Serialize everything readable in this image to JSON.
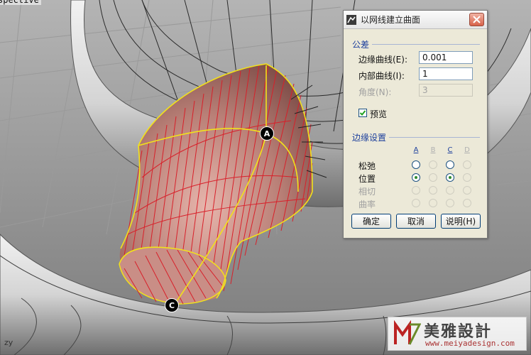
{
  "viewport": {
    "label": "spective",
    "markers": [
      {
        "letter": "A"
      },
      {
        "letter": "C"
      }
    ],
    "axis_label": "zy"
  },
  "dialog": {
    "title": "以网线建立曲面",
    "tolerance": {
      "header": "公差",
      "edge_curves": {
        "label": "边缘曲线(E):",
        "value": "0.001"
      },
      "inner_curves": {
        "label": "内部曲线(I):",
        "value": "1"
      },
      "angle": {
        "label": "角度(N):",
        "value": "3"
      }
    },
    "preview": {
      "label": "预览",
      "checked": true
    },
    "edge_settings": {
      "header": "边缘设置",
      "columns": [
        "A",
        "B",
        "C",
        "D"
      ],
      "rows": [
        {
          "label": "松弛",
          "states": [
            "empty",
            "disabled",
            "empty",
            "disabled"
          ]
        },
        {
          "label": "位置",
          "states": [
            "selected",
            "disabled",
            "selected",
            "disabled"
          ]
        },
        {
          "label": "相切",
          "states": [
            "disabled",
            "disabled",
            "disabled",
            "disabled"
          ]
        },
        {
          "label": "曲率",
          "states": [
            "disabled",
            "disabled",
            "disabled",
            "disabled"
          ]
        }
      ]
    },
    "buttons": {
      "ok": "确定",
      "cancel": "取消",
      "help": "说明(H)"
    }
  },
  "watermark": {
    "title": "美雅設計",
    "url": "www.meiyadesign.com"
  },
  "colors": {
    "surface_edge": "#f2e21a",
    "isocurve": "#d8202a",
    "dialog_bg": "#ece9d8",
    "section_header": "#1c3f9c"
  }
}
